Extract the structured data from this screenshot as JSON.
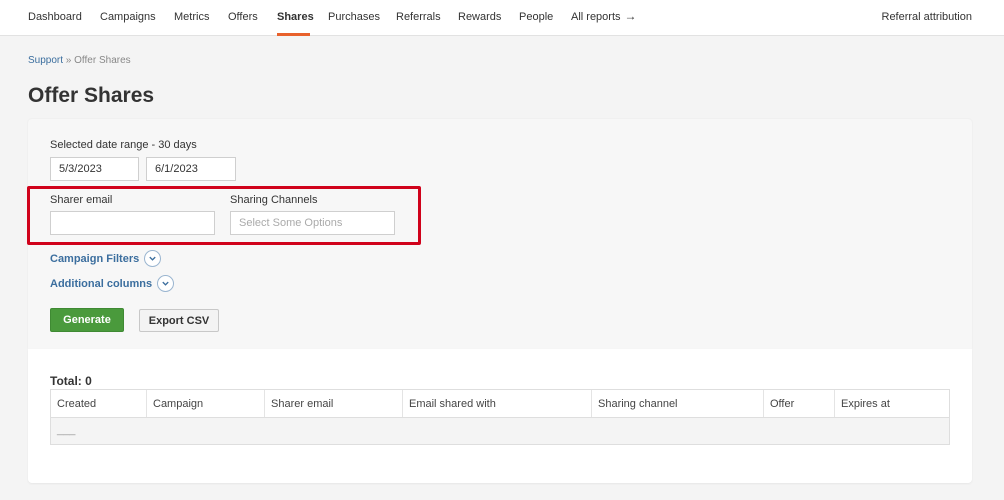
{
  "nav": {
    "items": [
      {
        "label": "Dashboard"
      },
      {
        "label": "Campaigns"
      },
      {
        "label": "Metrics"
      },
      {
        "label": "Offers"
      },
      {
        "label": "Shares"
      },
      {
        "label": "Purchases"
      },
      {
        "label": "Referrals"
      },
      {
        "label": "Rewards"
      },
      {
        "label": "People"
      },
      {
        "label": "All reports"
      }
    ],
    "active": "Shares",
    "right_link": "Referral attribution",
    "accent_color": "#e8612c"
  },
  "breadcrumb": {
    "link": "Support",
    "separator": " » ",
    "current": "Offer Shares"
  },
  "page_title": "Offer Shares",
  "filters": {
    "date_range_label": "Selected date range - 30 days",
    "start_date": "5/3/2023",
    "end_date": "6/1/2023",
    "sharer_email_label": "Sharer email",
    "sharer_email_value": "",
    "sharing_channels_label": "Sharing Channels",
    "sharing_channels_placeholder": "Select Some Options",
    "campaign_filters_label": "Campaign Filters",
    "additional_columns_label": "Additional columns",
    "generate_label": "Generate",
    "export_label": "Export CSV"
  },
  "results": {
    "total_label": "Total: 0",
    "columns": [
      "Created",
      "Campaign",
      "Sharer email",
      "Email shared with",
      "Sharing channel",
      "Offer",
      "Expires at"
    ],
    "empty_row": "___"
  },
  "colors": {
    "highlight": "#d0021b",
    "link": "#3b6e9e",
    "primary_button": "#4a9a3c"
  }
}
